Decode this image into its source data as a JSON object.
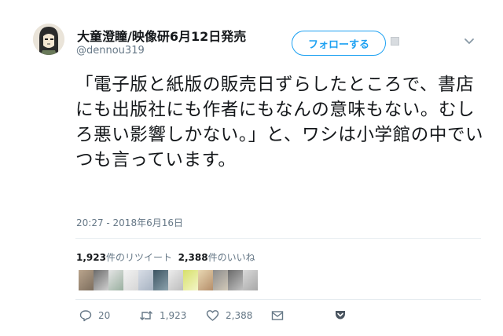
{
  "user": {
    "display_name": "大童澄瞳/映像研6月12日発売",
    "handle": "@dennou319",
    "avatar_icon": "avatar-illustration"
  },
  "follow_button": {
    "label": "フォローする"
  },
  "tweet": {
    "text": "「電子版と紙版の販売日ずらしたところで、書店にも出版社にも作者にもなんの意味もない。むしろ悪い影響しかない。」と、ワシは小学館の中でいつも言っています。",
    "timestamp": "20:27 - 2018年6月16日"
  },
  "stats": {
    "retweets_count": "1,923",
    "retweets_label": "件のリツイート",
    "likes_count": "2,388",
    "likes_label": "件のいいね"
  },
  "actions": {
    "reply_count": "20",
    "retweet_count": "1,923",
    "like_count": "2,388"
  },
  "colors": {
    "accent": "#1da1f2",
    "text": "#14171a",
    "muted": "#657786",
    "divider": "#e6ecf0"
  }
}
